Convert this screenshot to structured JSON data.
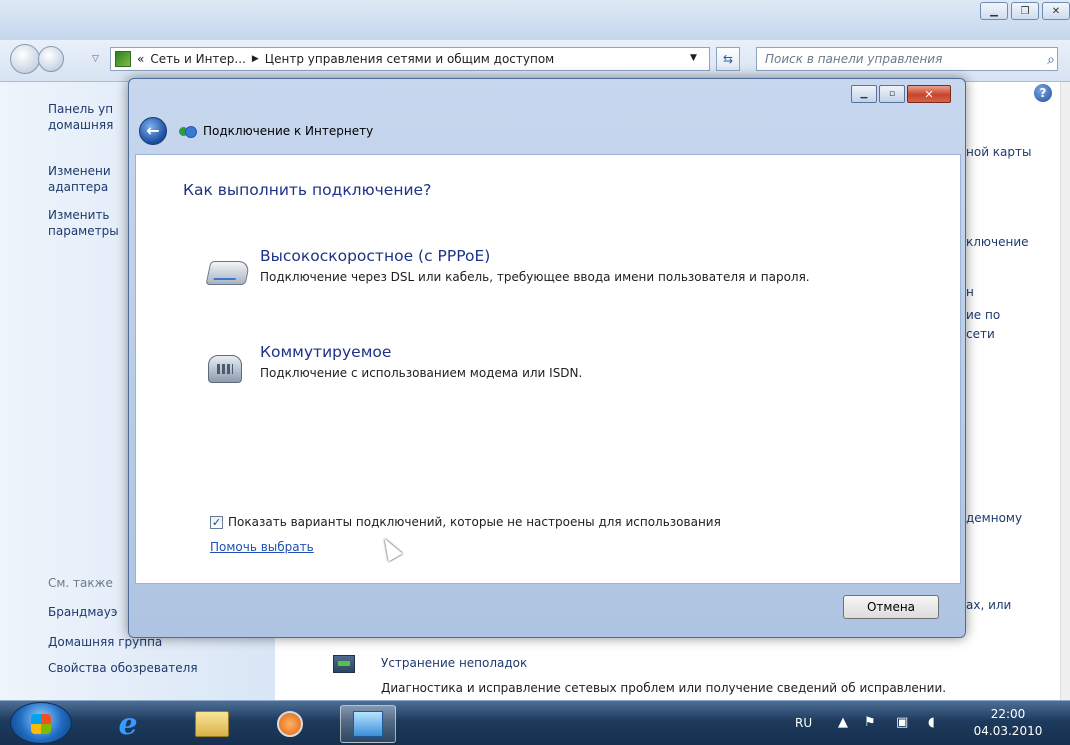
{
  "background_window": {
    "address_prefix": "«",
    "breadcrumb": [
      "Сеть и Интер...",
      "Центр управления сетями и общим доступом"
    ],
    "breadcrumb_separator": "▶",
    "search_placeholder": "Поиск в панели управления",
    "left_links": [
      "Панель уп домашняя",
      "Изменени адаптера",
      "Изменить параметры"
    ],
    "see_also_label": "См. также",
    "see_also_links": [
      "Брандмауэ",
      "Домашняя группа",
      "Свойства обозревателя"
    ],
    "right_fragments": [
      "ной карты",
      "ключение",
      "н",
      "ие по",
      "сети",
      "демному",
      "ах, или"
    ],
    "troubleshoot_title": "Устранение неполадок",
    "troubleshoot_desc": "Диагностика и исправление сетевых проблем или получение сведений об исправлении."
  },
  "dialog": {
    "title": "Подключение к Интернету",
    "heading": "Как выполнить подключение?",
    "options": [
      {
        "title": "Высокоскоростное (с PPPoE)",
        "description": "Подключение через DSL или кабель, требующее ввода имени пользователя и пароля.",
        "icon": "broadband-modem-icon"
      },
      {
        "title": "Коммутируемое",
        "description": "Подключение с использованием модема или ISDN.",
        "icon": "dialup-phone-icon"
      }
    ],
    "show_options_label": "Показать варианты подключений, которые не настроены для использования",
    "show_options_checked": true,
    "help_link": "Помочь выбрать",
    "cancel_label": "Отмена"
  },
  "taskbar": {
    "language": "RU",
    "time": "22:00",
    "date": "04.03.2010"
  }
}
